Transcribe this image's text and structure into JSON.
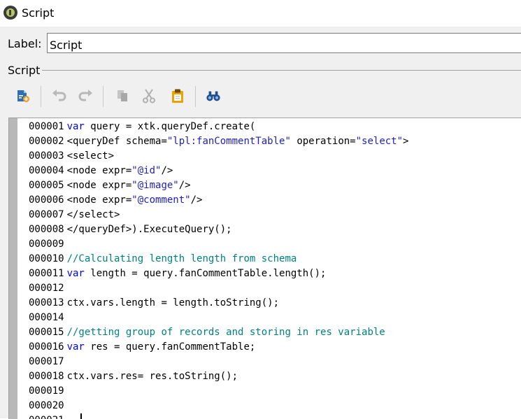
{
  "window": {
    "title": "Script"
  },
  "form": {
    "label_caption": "Label:",
    "label_value": "Script",
    "section_title": "Script"
  },
  "toolbar": {
    "buttons": [
      {
        "icon": "insert-field-icon",
        "enabled": true
      },
      {
        "icon": "undo-icon",
        "enabled": false
      },
      {
        "icon": "redo-icon",
        "enabled": false
      },
      {
        "icon": "copy-icon",
        "enabled": false
      },
      {
        "icon": "cut-icon",
        "enabled": false
      },
      {
        "icon": "paste-icon",
        "enabled": true
      },
      {
        "icon": "find-binoculars-icon",
        "enabled": true
      }
    ]
  },
  "editor": {
    "lines": [
      {
        "num": "000001",
        "segs": [
          {
            "t": "var",
            "c": "kw"
          },
          {
            "t": " query = xtk.queryDef.create(",
            "c": ""
          }
        ]
      },
      {
        "num": "000002",
        "segs": [
          {
            "t": "<queryDef schema=",
            "c": ""
          },
          {
            "t": "\"lpl:fanCommentTable\"",
            "c": "str"
          },
          {
            "t": " operation=",
            "c": ""
          },
          {
            "t": "\"select\"",
            "c": "str"
          },
          {
            "t": ">",
            "c": ""
          }
        ]
      },
      {
        "num": "000003",
        "segs": [
          {
            "t": "<select>",
            "c": ""
          }
        ]
      },
      {
        "num": "000004",
        "segs": [
          {
            "t": "<node expr=",
            "c": ""
          },
          {
            "t": "\"@id\"",
            "c": "str"
          },
          {
            "t": "/>",
            "c": ""
          }
        ]
      },
      {
        "num": "000005",
        "segs": [
          {
            "t": "<node expr=",
            "c": ""
          },
          {
            "t": "\"@image\"",
            "c": "str"
          },
          {
            "t": "/>",
            "c": ""
          }
        ]
      },
      {
        "num": "000006",
        "segs": [
          {
            "t": "<node expr=",
            "c": ""
          },
          {
            "t": "\"@comment\"",
            "c": "str"
          },
          {
            "t": "/>",
            "c": ""
          }
        ]
      },
      {
        "num": "000007",
        "segs": [
          {
            "t": "</select>",
            "c": ""
          }
        ]
      },
      {
        "num": "000008",
        "segs": [
          {
            "t": "</queryDef>).ExecuteQuery();",
            "c": ""
          }
        ]
      },
      {
        "num": "000009",
        "segs": []
      },
      {
        "num": "000010",
        "segs": [
          {
            "t": "//Calculating length length from schema",
            "c": "cm"
          }
        ]
      },
      {
        "num": "000011",
        "segs": [
          {
            "t": "var",
            "c": "kw"
          },
          {
            "t": " length = query.fanCommentTable.length();",
            "c": ""
          }
        ]
      },
      {
        "num": "000012",
        "segs": []
      },
      {
        "num": "000013",
        "segs": [
          {
            "t": "ctx.vars.length = length.toString();",
            "c": ""
          }
        ]
      },
      {
        "num": "000014",
        "segs": []
      },
      {
        "num": "000015",
        "segs": [
          {
            "t": "//getting group of records and storing in res variable",
            "c": "cm"
          }
        ]
      },
      {
        "num": "000016",
        "segs": [
          {
            "t": "var",
            "c": "kw"
          },
          {
            "t": " res = query.fanCommentTable;",
            "c": ""
          }
        ]
      },
      {
        "num": "000017",
        "segs": []
      },
      {
        "num": "000018",
        "segs": [
          {
            "t": "ctx.vars.res= res.toString();",
            "c": ""
          }
        ]
      },
      {
        "num": "000019",
        "segs": []
      },
      {
        "num": "000020",
        "segs": []
      },
      {
        "num": "000021",
        "segs": []
      }
    ]
  }
}
